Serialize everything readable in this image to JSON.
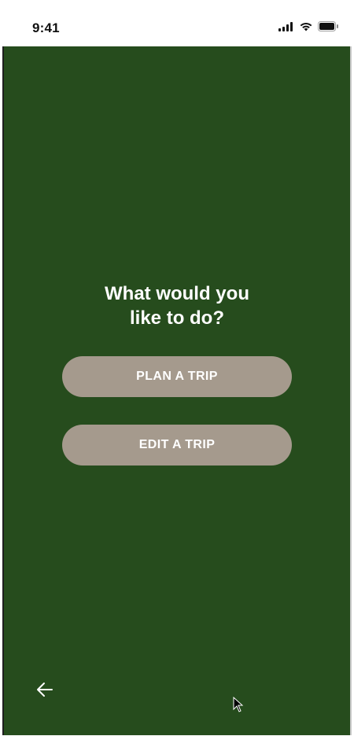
{
  "status_bar": {
    "time": "9:41",
    "icons": [
      "signal-icon",
      "wifi-icon",
      "battery-icon"
    ]
  },
  "main": {
    "headline_line1": "What would you",
    "headline_line2": "like to do?",
    "buttons": [
      {
        "label": "PLAN A TRIP"
      },
      {
        "label": "EDIT A TRIP"
      }
    ]
  },
  "footer": {
    "back_icon": "arrow-left-icon"
  },
  "colors": {
    "background": "#264c1d",
    "button": "#a59a8d",
    "text": "#ffffff"
  }
}
